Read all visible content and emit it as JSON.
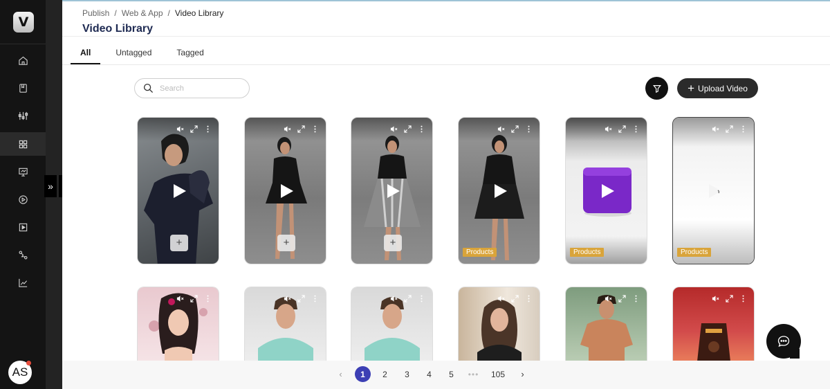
{
  "app": {
    "logo_letter": "V"
  },
  "sidebar": {
    "items": [
      {
        "name": "home-icon"
      },
      {
        "name": "book-icon"
      },
      {
        "name": "sliders-icon"
      },
      {
        "name": "grid-icon",
        "active": true
      },
      {
        "name": "presentation-icon"
      },
      {
        "name": "play-circle-icon"
      },
      {
        "name": "play-square-icon"
      },
      {
        "name": "route-icon"
      },
      {
        "name": "line-chart-icon"
      }
    ],
    "expand_glyph": "»",
    "avatar_initials": "AS"
  },
  "breadcrumb": {
    "items": [
      "Publish",
      "/",
      "Web & App",
      "/"
    ],
    "current": "Video Library"
  },
  "page_title": "Video Library",
  "tabs": [
    {
      "label": "All",
      "active": true
    },
    {
      "label": "Untagged"
    },
    {
      "label": "Tagged"
    }
  ],
  "search": {
    "placeholder": "Search",
    "value": ""
  },
  "toolbar": {
    "upload_label": "Upload Video",
    "upload_glyph": "+"
  },
  "videos_row1": [
    {
      "tag": "",
      "add": "+",
      "muted": true
    },
    {
      "tag": "",
      "add": "+",
      "muted": true
    },
    {
      "tag": "",
      "add": "+",
      "muted": true
    },
    {
      "tag": "Products",
      "muted": true
    },
    {
      "tag": "Products",
      "muted": true
    },
    {
      "tag": "Products",
      "muted": true
    }
  ],
  "pagination": {
    "prev": "‹",
    "pages": [
      "1",
      "2",
      "3",
      "4",
      "5"
    ],
    "ellipsis": "•••",
    "last": "105",
    "next": "›",
    "current": "1"
  },
  "colors": {
    "accent": "#3c3fb4",
    "tag": "#d9a43a",
    "sidebar": "#141414",
    "title": "#1e2a52"
  }
}
